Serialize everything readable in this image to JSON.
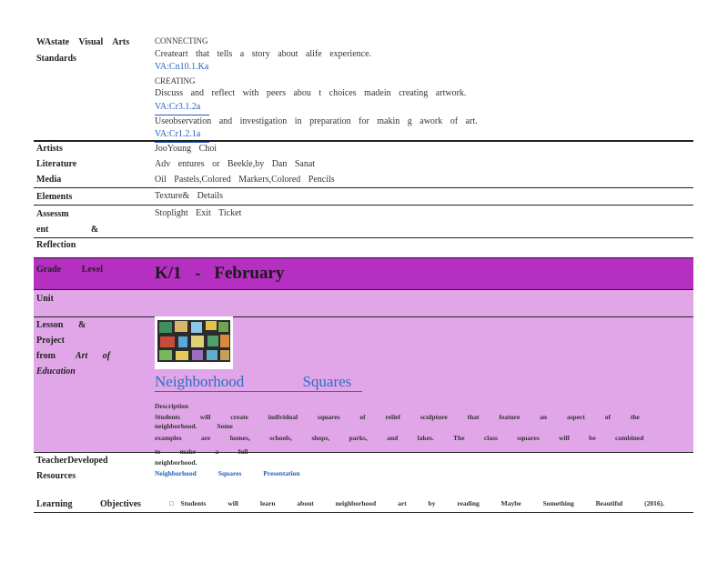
{
  "standards": {
    "label": "WAstate Visual Arts Standards",
    "connecting_heading": "CONNECTING",
    "connecting_text": "Createart that tells a story about alife experience.",
    "connecting_code": "VA:Cn10.1.Ka",
    "creating_heading": "CREATING",
    "creating_text": "Discuss and reflect with peers abou t choices madein creating artwork.",
    "creating_code1": "VA:Cr3.1.2a",
    "creating_text2": "Useobservation and investigation in preparation for makin g awork of art.",
    "creating_code2": "VA:Cr1.2.1a"
  },
  "rows": {
    "artists_label": "Artists",
    "artists_value": "JooYoung Choi",
    "literature_label": "Literature",
    "literature_value": "Adv entures or Beekle,by Dan Sanat",
    "media_label": "Media",
    "media_value": "Oil Pastels,Colored Markers,Colored Pencils",
    "elements_label": "Elements",
    "elements_value": "Texture& Details",
    "assessment_label1": "Assessm ent &",
    "assessment_label2": "Reflection",
    "assessment_value": "Stoplight Exit Ticket"
  },
  "lesson_table": {
    "grade_label": "Grade Level",
    "grade_value": "K/1 - February",
    "unit_label": "Unit",
    "lesson_label_1": "Lesson & Project",
    "lesson_label_2a": "from",
    "lesson_label_2b": "Art of",
    "lesson_label_3": "Education",
    "lesson_title": "Neighborhood Squares",
    "description_heading": "Description",
    "description_line1": "Students will create individual squares of relief sculpture that feature an aspect of the neighborhood. Some",
    "description_line2": "examples are homes, schools, shops, parks, and lakes. The class squares will be combined to make a full",
    "description_line3": "neighborhood.",
    "teacher_label_1": "TeacherDeveloped",
    "teacher_label_2": "Resources",
    "teacher_value": "Neighborhood Squares Presentation",
    "objectives_label": "Learning Objectives",
    "objective_bullet": "□",
    "objective_text": "Students will learn about neighborhood art by reading Maybe Something Beautiful (2016)."
  },
  "colors": {
    "grade_band": "#b52fc0",
    "lesson_band": "#e0a6e8",
    "link_blue": "#1f5fbf",
    "title_blue": "#2a6fc9"
  },
  "icons": {
    "thumbnail": "neighborhood-squares-artwork-image"
  }
}
